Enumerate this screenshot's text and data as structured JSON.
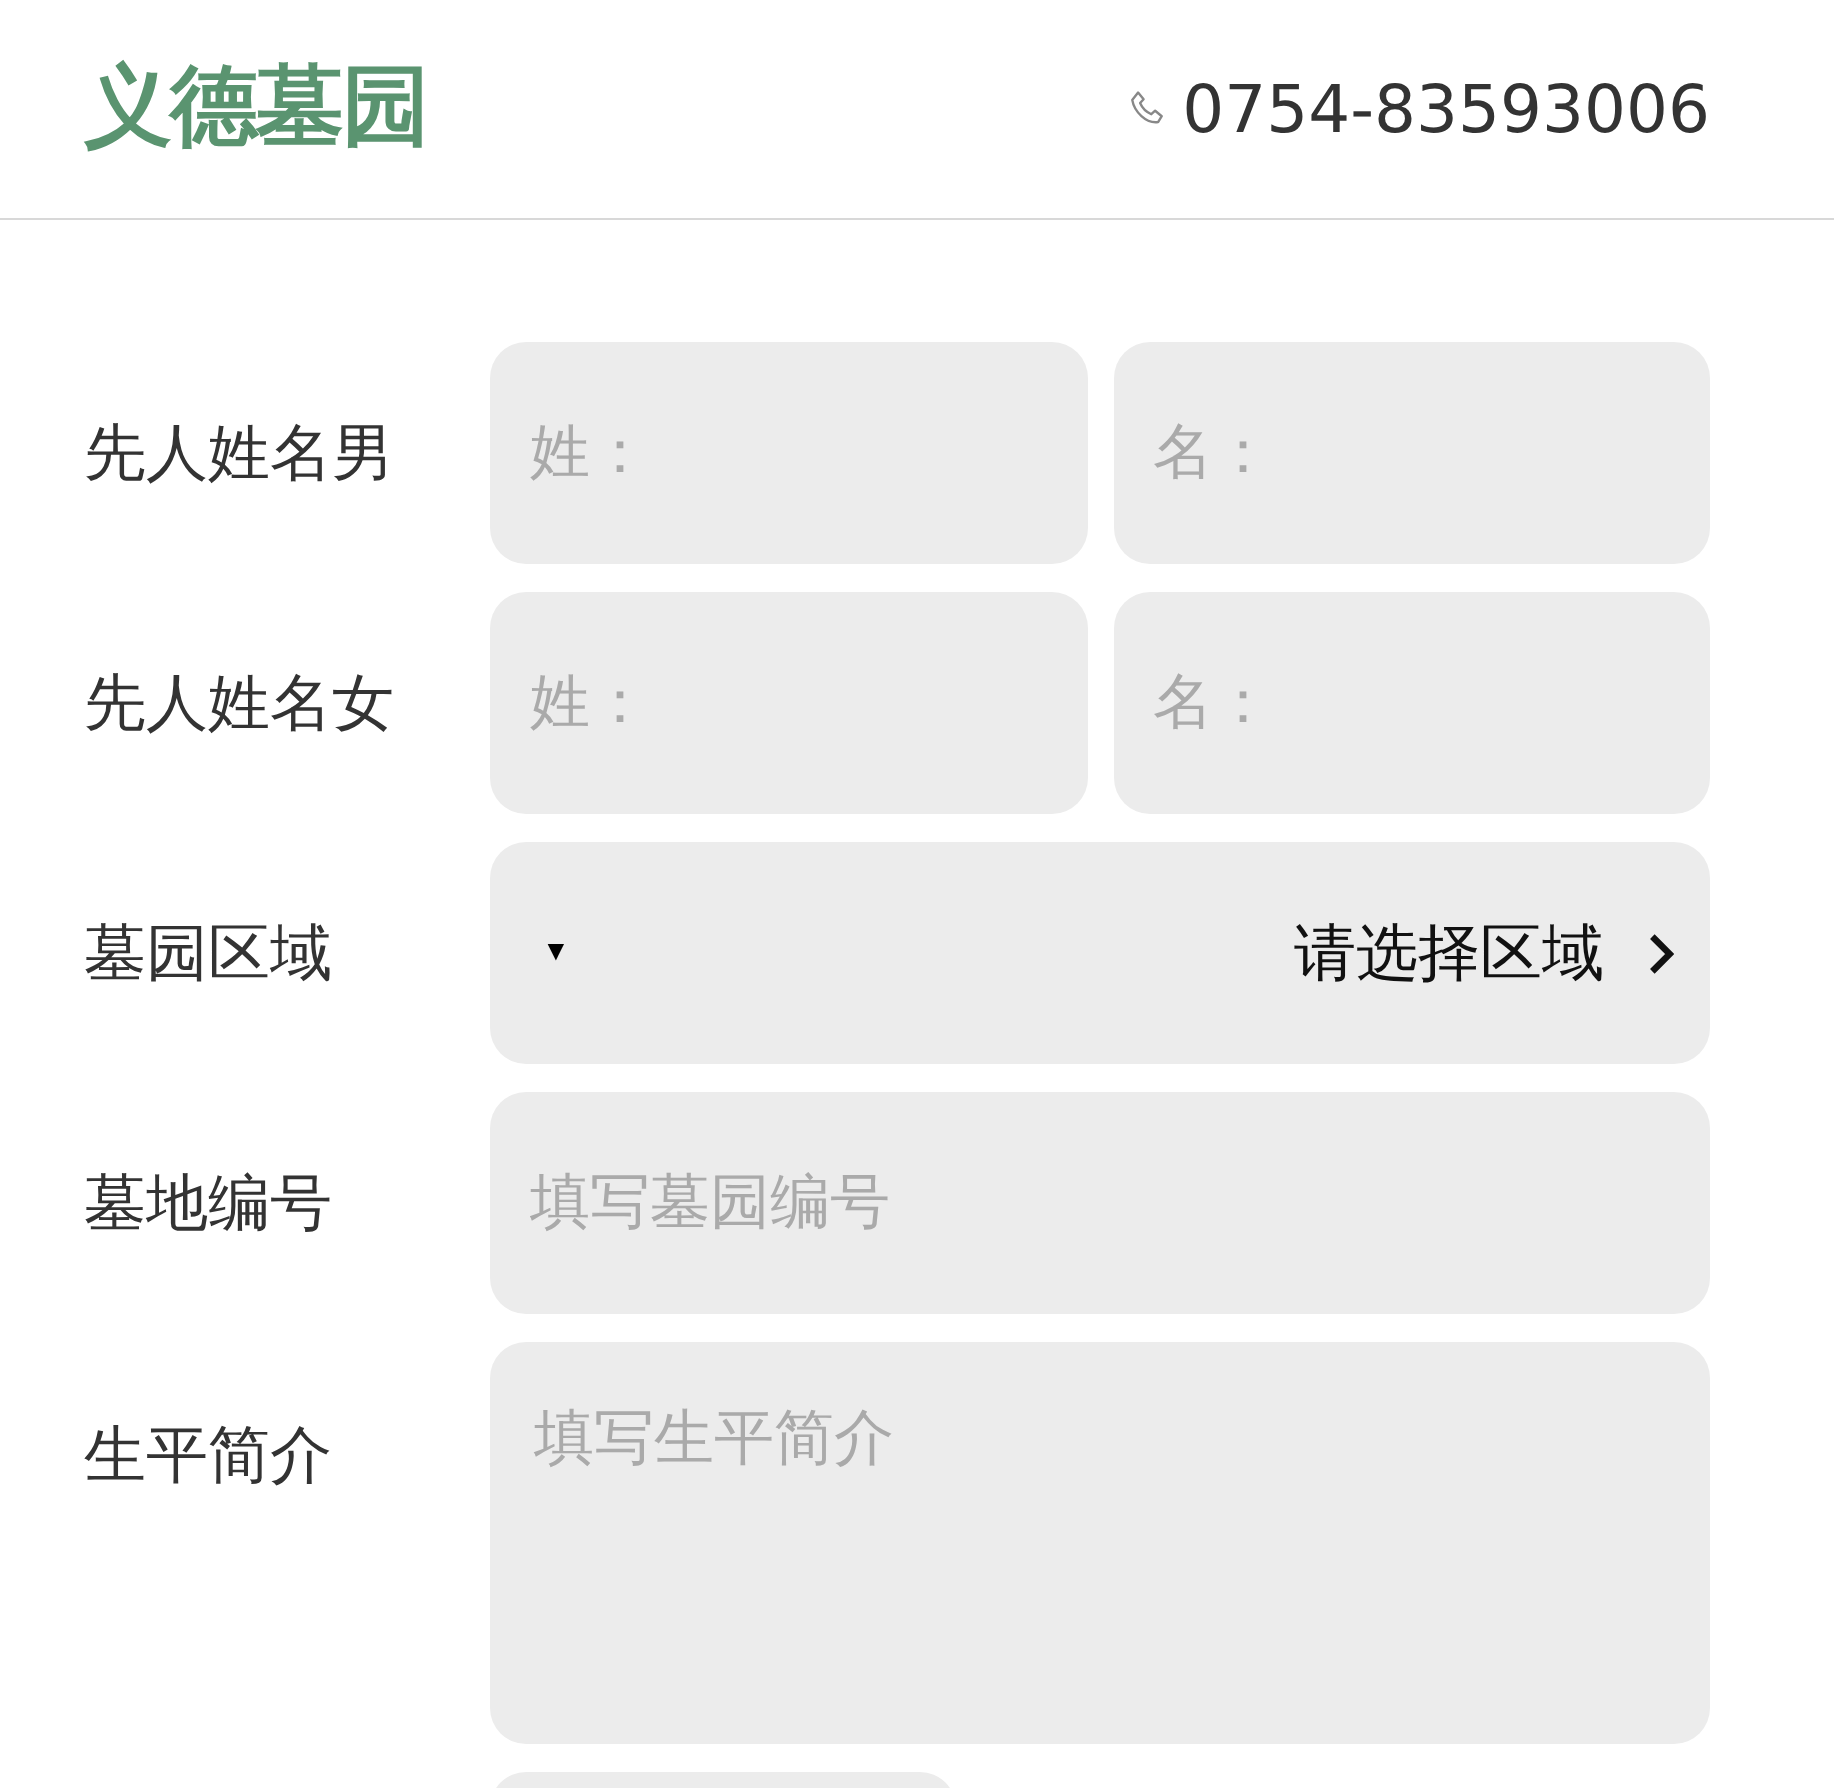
{
  "header": {
    "logo": "义德墓园",
    "phone": "0754-83593006"
  },
  "form": {
    "rows": [
      {
        "kind": "pair",
        "label": "先人姓名男",
        "fields": [
          {
            "placeholder": "姓："
          },
          {
            "placeholder": "名："
          }
        ]
      },
      {
        "kind": "pair",
        "label": "先人姓名女",
        "fields": [
          {
            "placeholder": "姓："
          },
          {
            "placeholder": "名："
          }
        ]
      },
      {
        "kind": "select",
        "label": "墓园区域",
        "marker": "▼",
        "value": "请选择区域"
      },
      {
        "kind": "input",
        "label": "墓地编号",
        "placeholder": "填写墓园编号"
      },
      {
        "kind": "textarea",
        "label": "生平简介",
        "placeholder": "填写生平简介"
      }
    ]
  }
}
